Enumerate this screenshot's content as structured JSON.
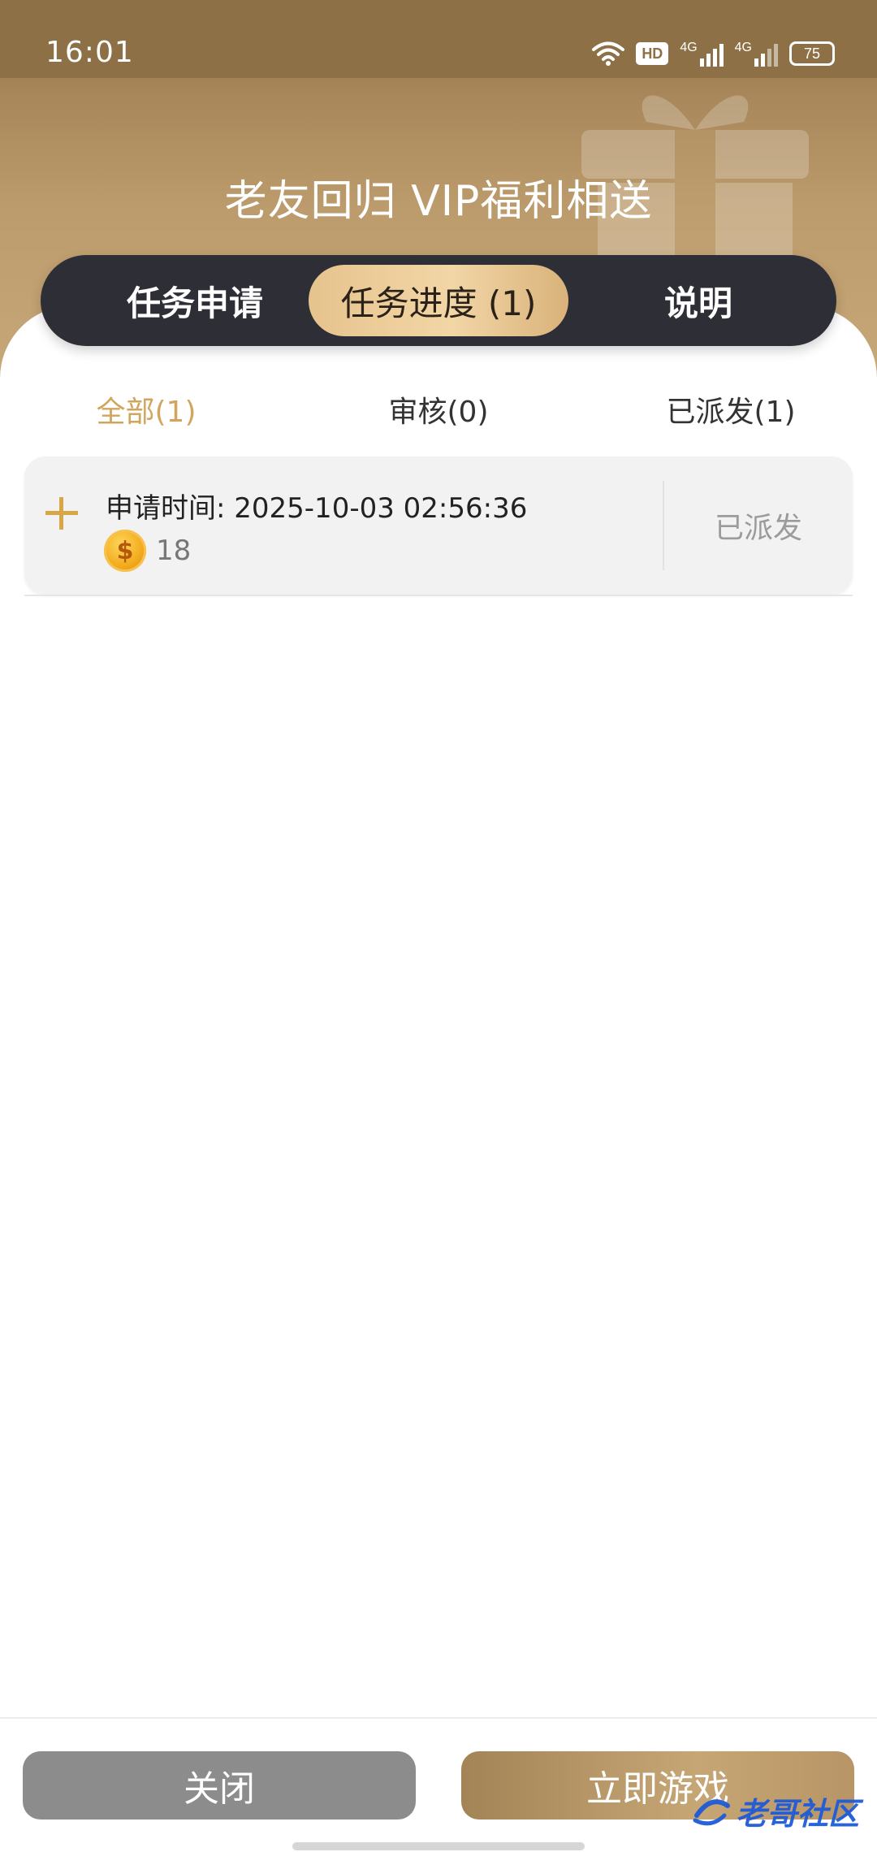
{
  "status_bar": {
    "time": "16:01",
    "battery": "75",
    "hd_label": "HD",
    "net_1": "4G",
    "net_2": "4G"
  },
  "header": {
    "title": "老友回归 VIP福利相送"
  },
  "tabs": [
    {
      "label": "任务申请"
    },
    {
      "label": "任务进度 (1)"
    },
    {
      "label": "说明"
    }
  ],
  "filters": [
    {
      "label": "全部(1)"
    },
    {
      "label": "审核(0)"
    },
    {
      "label": "已派发(1)"
    }
  ],
  "records": [
    {
      "apply_time": "申请时间: 2025-10-03 02:56:36",
      "coin_amount": "18",
      "status": "已派发"
    }
  ],
  "footer": {
    "close_label": "关闭",
    "play_label": "立即游戏"
  },
  "watermark": {
    "text": "老哥社区"
  },
  "colors": {
    "accent": "#d2a55c",
    "tabbar": "#2e2e36",
    "header_brown": "#a8875a"
  }
}
